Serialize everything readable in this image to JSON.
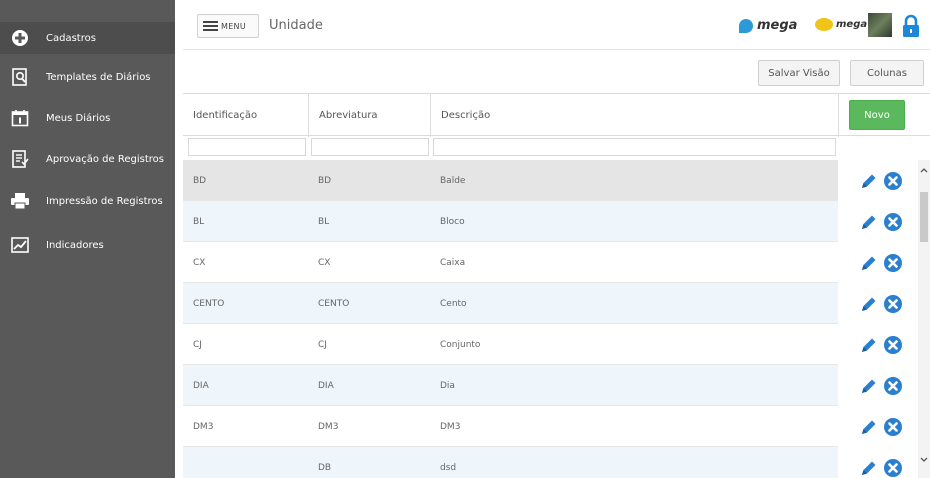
{
  "sidebar": {
    "items": [
      {
        "label": "Cadastros",
        "icon": "plus-circle-icon"
      },
      {
        "label": "Templates de Diários",
        "icon": "document-search-icon"
      },
      {
        "label": "Meus Diários",
        "icon": "calendar-icon"
      },
      {
        "label": "Aprovação de Registros",
        "icon": "checklist-icon"
      },
      {
        "label": "Impressão de Registros",
        "icon": "printer-icon"
      },
      {
        "label": "Indicadores",
        "icon": "chart-icon"
      }
    ]
  },
  "header": {
    "menu_label": "MENU",
    "title": "Unidade",
    "logo1_text": "mega",
    "logo2_text": "mega"
  },
  "toolbar": {
    "save_view_label": "Salvar Visão",
    "columns_label": "Colunas"
  },
  "table": {
    "columns": [
      "Identificação",
      "Abreviatura",
      "Descrição"
    ],
    "new_label": "Novo",
    "rows": [
      {
        "id": "BD",
        "abbr": "BD",
        "desc": "Balde"
      },
      {
        "id": "BL",
        "abbr": "BL",
        "desc": "Bloco"
      },
      {
        "id": "CX",
        "abbr": "CX",
        "desc": "Caixa"
      },
      {
        "id": "CENTO",
        "abbr": "CENTO",
        "desc": "Cento"
      },
      {
        "id": "CJ",
        "abbr": "CJ",
        "desc": "Conjunto"
      },
      {
        "id": "DIA",
        "abbr": "DIA",
        "desc": "Dia"
      },
      {
        "id": "DM3",
        "abbr": "DM3",
        "desc": "DM3"
      },
      {
        "id": "",
        "abbr": "DB",
        "desc": "dsd"
      }
    ]
  },
  "colors": {
    "sidebar_bg": "#595959",
    "accent_blue": "#2a7fcf",
    "new_button": "#5cb85c",
    "row_selected": "#e5e5e5",
    "row_alt": "#eef5fb"
  }
}
